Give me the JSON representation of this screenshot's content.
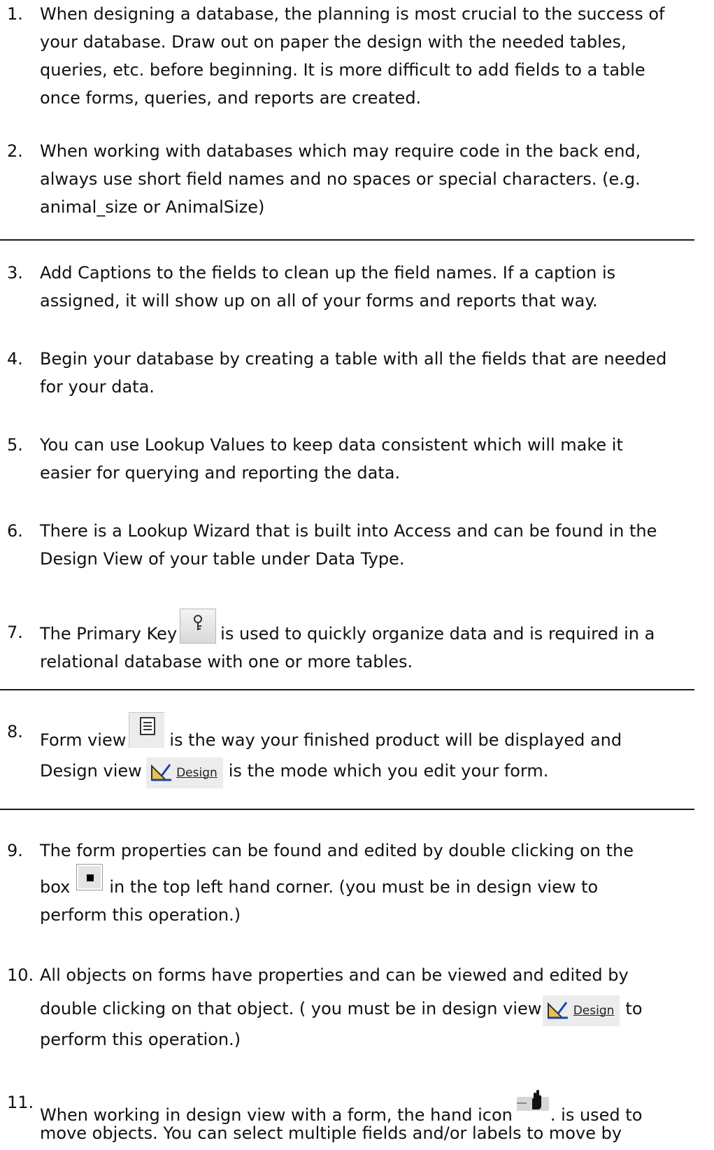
{
  "items": [
    {
      "n": "1.",
      "lines": [
        "When designing a database, the planning is most crucial to the success of",
        "your database. Draw out on paper the design with the needed tables,",
        "queries, etc. before beginning. It is more difficult to add fields to a table",
        "once forms, queries, and reports are created."
      ]
    },
    {
      "n": "2.",
      "lines": [
        "When working with databases which may require code in the back end,",
        "always use short field names and no spaces or special characters. (e.g.",
        "animal_size or AnimalSize)"
      ]
    },
    {
      "n": "3.",
      "lines": [
        "Add Captions to the fields to clean up the field names. If a caption is",
        "assigned, it will show up on all of your forms and reports that way."
      ]
    },
    {
      "n": "4.",
      "lines": [
        "Begin your database by creating a table with all the fields that are needed",
        "for your data."
      ]
    },
    {
      "n": "5.",
      "lines": [
        "You can use Lookup Values to keep data consistent which will make it",
        "easier for querying and reporting the data."
      ]
    },
    {
      "n": "6.",
      "lines": [
        "There is a Lookup Wizard that is built into Access and can be found in the",
        "Design View of your table under Data Type."
      ]
    },
    {
      "n": "7.",
      "a": "The Primary Key",
      "b": "is used to quickly organize data and is required in a",
      "c": "relational database with one or more tables."
    },
    {
      "n": "8.",
      "a": "Form view",
      "b": "is the way your finished product will be displayed and",
      "c": "Design view",
      "d": "is the mode which you edit your form."
    },
    {
      "n": "9.",
      "a": "The form properties can be found and edited by double clicking on the",
      "b": "box",
      "c": "in the top left hand corner. (you must be in design view to",
      "d": "perform this operation.)"
    },
    {
      "n": "10.",
      "a": "All objects on forms have properties and can be viewed and edited by",
      "b": "double clicking on that object. ( you must be in design view",
      "c": "to",
      "d": "perform this operation.)"
    },
    {
      "n": "11.",
      "a": "When working in design view with a form, the hand icon",
      "b": ". is used to",
      "c": "move objects. You can select multiple fields and/or labels to move by"
    }
  ],
  "design_button_label": "Design",
  "icons": {
    "primary_key": "primary-key-icon",
    "form_view": "form-view-icon",
    "design_view": "design-view-icon",
    "form_selector": "form-selector-box-icon",
    "hand": "hand-move-icon"
  }
}
